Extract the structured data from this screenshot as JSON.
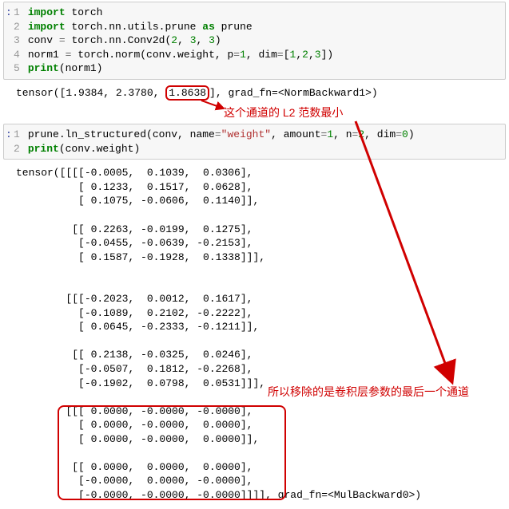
{
  "cell1": {
    "line1_kw1": "import",
    "line1_rest": " torch",
    "line2_kw1": "import",
    "line2_mid": " torch.nn.utils.prune ",
    "line2_kw2": "as",
    "line2_rest": " prune",
    "line3_a": "conv ",
    "line3_eq": "=",
    "line3_b": " torch.nn.Conv2d(",
    "line3_n1": "2",
    "line3_c1": ", ",
    "line3_n2": "3",
    "line3_c2": ", ",
    "line3_n3": "3",
    "line3_c3": ")",
    "line4_a": "norm1 ",
    "line4_eq": "=",
    "line4_b": " torch.norm(conv.weight, p",
    "line4_eq2": "=",
    "line4_n1": "1",
    "line4_c1": ", dim",
    "line4_eq3": "=",
    "line4_c2": "[",
    "line4_n2": "1",
    "line4_c3": ",",
    "line4_n3": "2",
    "line4_c4": ",",
    "line4_n4": "3",
    "line4_c5": "])",
    "line5_kw": "print",
    "line5_rest": "(norm1)"
  },
  "gutter1": "1\n2\n3\n4\n5",
  "output1_pre": "tensor([1.9384, 2.3780, ",
  "output1_hl": "1.8638",
  "output1_post": "], grad_fn=<NormBackward1>)",
  "annotation1": "这个通道的 L2 范数最小",
  "cell2": {
    "line1_a": "prune.ln_structured(conv, name",
    "line1_eq1": "=",
    "line1_s1": "\"weight\"",
    "line1_c1": ", amount",
    "line1_eq2": "=",
    "line1_n1": "1",
    "line1_c2": ", n",
    "line1_eq3": "=",
    "line1_n2": "2",
    "line1_c3": ", dim",
    "line1_eq4": "=",
    "line1_n3": "0",
    "line1_c4": ")",
    "line2_kw": "print",
    "line2_rest": "(conv.weight)"
  },
  "gutter2": "1\n2",
  "output2_top": "tensor([[[[-0.0005,  0.1039,  0.0306],\n          [ 0.1233,  0.1517,  0.0628],\n          [ 0.1075, -0.0606,  0.1140]],\n\n         [[ 0.2263, -0.0199,  0.1275],\n          [-0.0455, -0.0639, -0.2153],\n          [ 0.1587, -0.1928,  0.1338]]],\n\n\n        [[[-0.2023,  0.0012,  0.1617],\n          [-0.1089,  0.2102, -0.2222],\n          [ 0.0645, -0.2333, -0.1211]],\n\n         [[ 0.2138, -0.0325,  0.0246],\n          [-0.0507,  0.1812, -0.2268],\n          [-0.1902,  0.0798,  0.0531]]],\n\n",
  "output2_zero": "        [[[ 0.0000, -0.0000, -0.0000],\n          [ 0.0000, -0.0000,  0.0000],\n          [ 0.0000, -0.0000,  0.0000]],\n\n         [[ 0.0000,  0.0000,  0.0000],\n          [-0.0000,  0.0000, -0.0000],\n          [-0.0000, -0.0000, -0.0000]]]]",
  "output2_tail": ", grad_fn=<MulBackward0>)",
  "annotation2": "所以移除的是卷积层参数的最后一个通道",
  "chart_data": {
    "type": "table",
    "title": "PyTorch ln_structured pruning example",
    "norm1_tensor": [
      1.9384,
      2.378,
      1.8638
    ],
    "norm1_grad_fn": "NormBackward1",
    "min_norm_index": 2,
    "prune_call": {
      "module": "conv",
      "name": "weight",
      "amount": 1,
      "n": 2,
      "dim": 0
    },
    "conv_weight_after_prune": [
      [
        [
          [
            -0.0005,
            0.1039,
            0.0306
          ],
          [
            0.1233,
            0.1517,
            0.0628
          ],
          [
            0.1075,
            -0.0606,
            0.114
          ]
        ],
        [
          [
            0.2263,
            -0.0199,
            0.1275
          ],
          [
            -0.0455,
            -0.0639,
            -0.2153
          ],
          [
            0.1587,
            -0.1928,
            0.1338
          ]
        ]
      ],
      [
        [
          [
            -0.2023,
            0.0012,
            0.1617
          ],
          [
            -0.1089,
            0.2102,
            -0.2222
          ],
          [
            0.0645,
            -0.2333,
            -0.1211
          ]
        ],
        [
          [
            0.2138,
            -0.0325,
            0.0246
          ],
          [
            -0.0507,
            0.1812,
            -0.2268
          ],
          [
            -0.1902,
            0.0798,
            0.0531
          ]
        ]
      ],
      [
        [
          [
            0.0,
            -0.0,
            -0.0
          ],
          [
            0.0,
            -0.0,
            0.0
          ],
          [
            0.0,
            -0.0,
            0.0
          ]
        ],
        [
          [
            0.0,
            0.0,
            0.0
          ],
          [
            -0.0,
            0.0,
            -0.0
          ],
          [
            -0.0,
            -0.0,
            -0.0
          ]
        ]
      ]
    ],
    "conv_weight_grad_fn": "MulBackward0"
  }
}
